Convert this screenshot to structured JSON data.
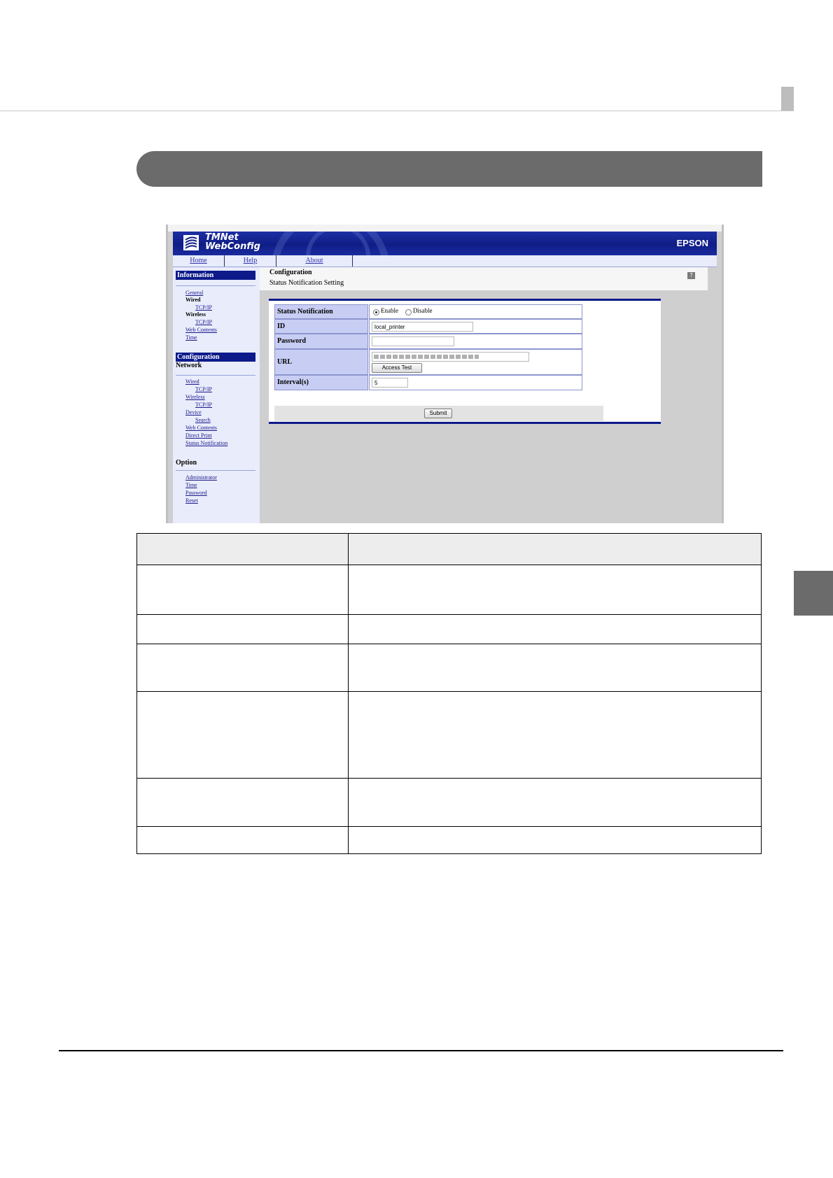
{
  "app": {
    "logo_line1": "TMNet",
    "logo_line2": "WebConfig",
    "brand": "EPSON"
  },
  "nav": {
    "items": [
      "Home",
      "Help",
      "About"
    ]
  },
  "sidebar": {
    "information": {
      "header": "Information",
      "links": [
        "General",
        "Wired",
        "TCP/IP",
        "Wireless",
        "TCP/IP",
        "Web Contents",
        "Time"
      ]
    },
    "configuration": {
      "header": "Configuration",
      "subheader": "Network",
      "links": [
        "Wired",
        "TCP/IP",
        "Wireless",
        "TCP/IP",
        "Device",
        "Search",
        "Web Contents",
        "Direct Print",
        "Status Notification"
      ]
    },
    "option": {
      "header": "Option",
      "links": [
        "Administrator",
        "Time",
        "Password",
        "Reset"
      ]
    }
  },
  "content": {
    "title": "Configuration",
    "subtitle": "Status Notification Setting",
    "help_icon": "?"
  },
  "form": {
    "status_label": "Status Notification",
    "enable_label": "Enable",
    "disable_label": "Disable",
    "enabled": true,
    "id_label": "ID",
    "id_value": "local_printer",
    "password_label": "Password",
    "password_value": "",
    "url_label": "URL",
    "url_value": "",
    "access_test_label": "Access Test",
    "interval_label": "Interval(s)",
    "interval_value": "5",
    "submit_label": "Submit"
  },
  "colors": {
    "banner": "#0f1d86",
    "row_label_bg": "#c8cdf3",
    "section_bar": "#6b6b6b"
  }
}
